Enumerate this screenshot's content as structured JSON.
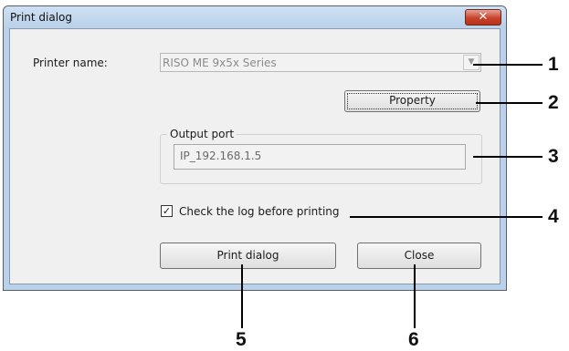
{
  "window": {
    "title": "Print dialog",
    "close_glyph": "✕",
    "close_icon": "close-icon",
    "title_bar_color": "#b9d1ea",
    "close_color": "#c8432c"
  },
  "form": {
    "printer_name_label": "Printer name:",
    "printer_name_value": "RISO ME 9x5x Series",
    "dropdown_glyph": "▼",
    "dropdown_icon": "chevron-down-icon",
    "property_label": "Property",
    "output_port_legend": "Output port",
    "output_port_value": "IP_192.168.1.5",
    "log_check_glyph": "✓",
    "log_checked": true,
    "log_label": "Check the log before printing"
  },
  "buttons": {
    "print_dialog_label": "Print dialog",
    "close_label": "Close"
  },
  "callouts": [
    "1",
    "2",
    "3",
    "4",
    "5",
    "6"
  ]
}
